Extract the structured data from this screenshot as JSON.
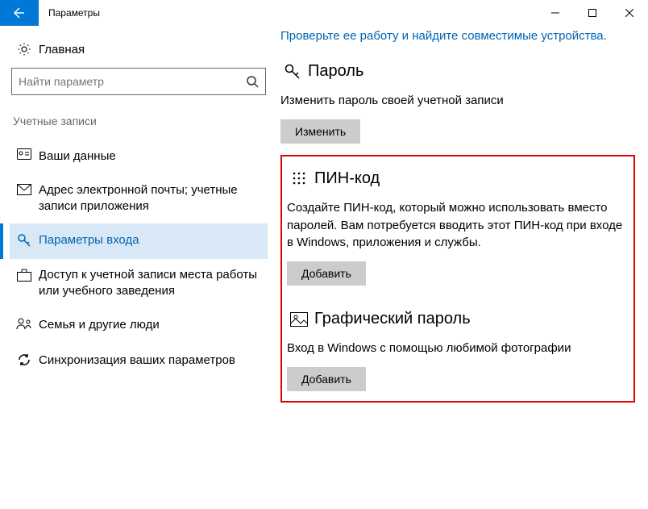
{
  "titlebar": {
    "title": "Параметры"
  },
  "sidebar": {
    "home": "Главная",
    "search_placeholder": "Найти параметр",
    "section": "Учетные записи",
    "items": [
      {
        "label": "Ваши данные"
      },
      {
        "label": "Адрес электронной почты; учетные записи приложения"
      },
      {
        "label": "Параметры входа"
      },
      {
        "label": "Доступ к учетной записи места работы или учебного заведения"
      },
      {
        "label": "Семья и другие люди"
      },
      {
        "label": "Синхронизация ваших параметров"
      }
    ]
  },
  "content": {
    "toplink": "Проверьте ее работу и найдите совместимые устройства.",
    "password": {
      "title": "Пароль",
      "desc": "Изменить пароль своей учетной записи",
      "btn": "Изменить"
    },
    "pin": {
      "title": "ПИН-код",
      "desc": "Создайте ПИН-код, который можно использовать вместо паролей. Вам потребуется вводить этот ПИН-код при входе в Windows, приложения и службы.",
      "btn": "Добавить"
    },
    "picture": {
      "title": "Графический пароль",
      "desc": "Вход в Windows с помощью любимой фотографии",
      "btn": "Добавить"
    }
  }
}
